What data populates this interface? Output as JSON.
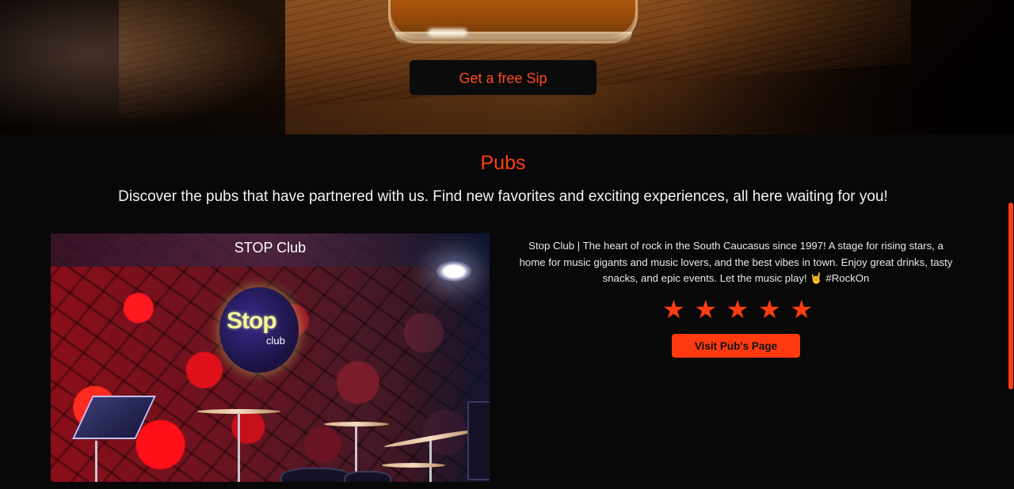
{
  "hero": {
    "cta_label": "Get a free Sip"
  },
  "pubs_section": {
    "title": "Pubs",
    "subtitle": "Discover the pubs that have partnered with us. Find new favorites and exciting experiences, all here waiting for you!"
  },
  "pub_card": {
    "name": "STOP Club",
    "logo_word": "Stop",
    "logo_sub": "club",
    "description": "Stop Club | The heart of rock in the South Caucasus since 1997! A stage for rising stars, a home for music gigants and music lovers, and the best vibes in town. Enjoy great drinks, tasty snacks, and epic events. Let the music play! 🤘 #RockOn",
    "rating": 5,
    "rating_max": 5,
    "star_glyph": "★",
    "visit_label": "Visit Pub's Page"
  },
  "colors": {
    "accent": "#ff3d14",
    "background": "#080808",
    "text": "#f2f2f2"
  }
}
